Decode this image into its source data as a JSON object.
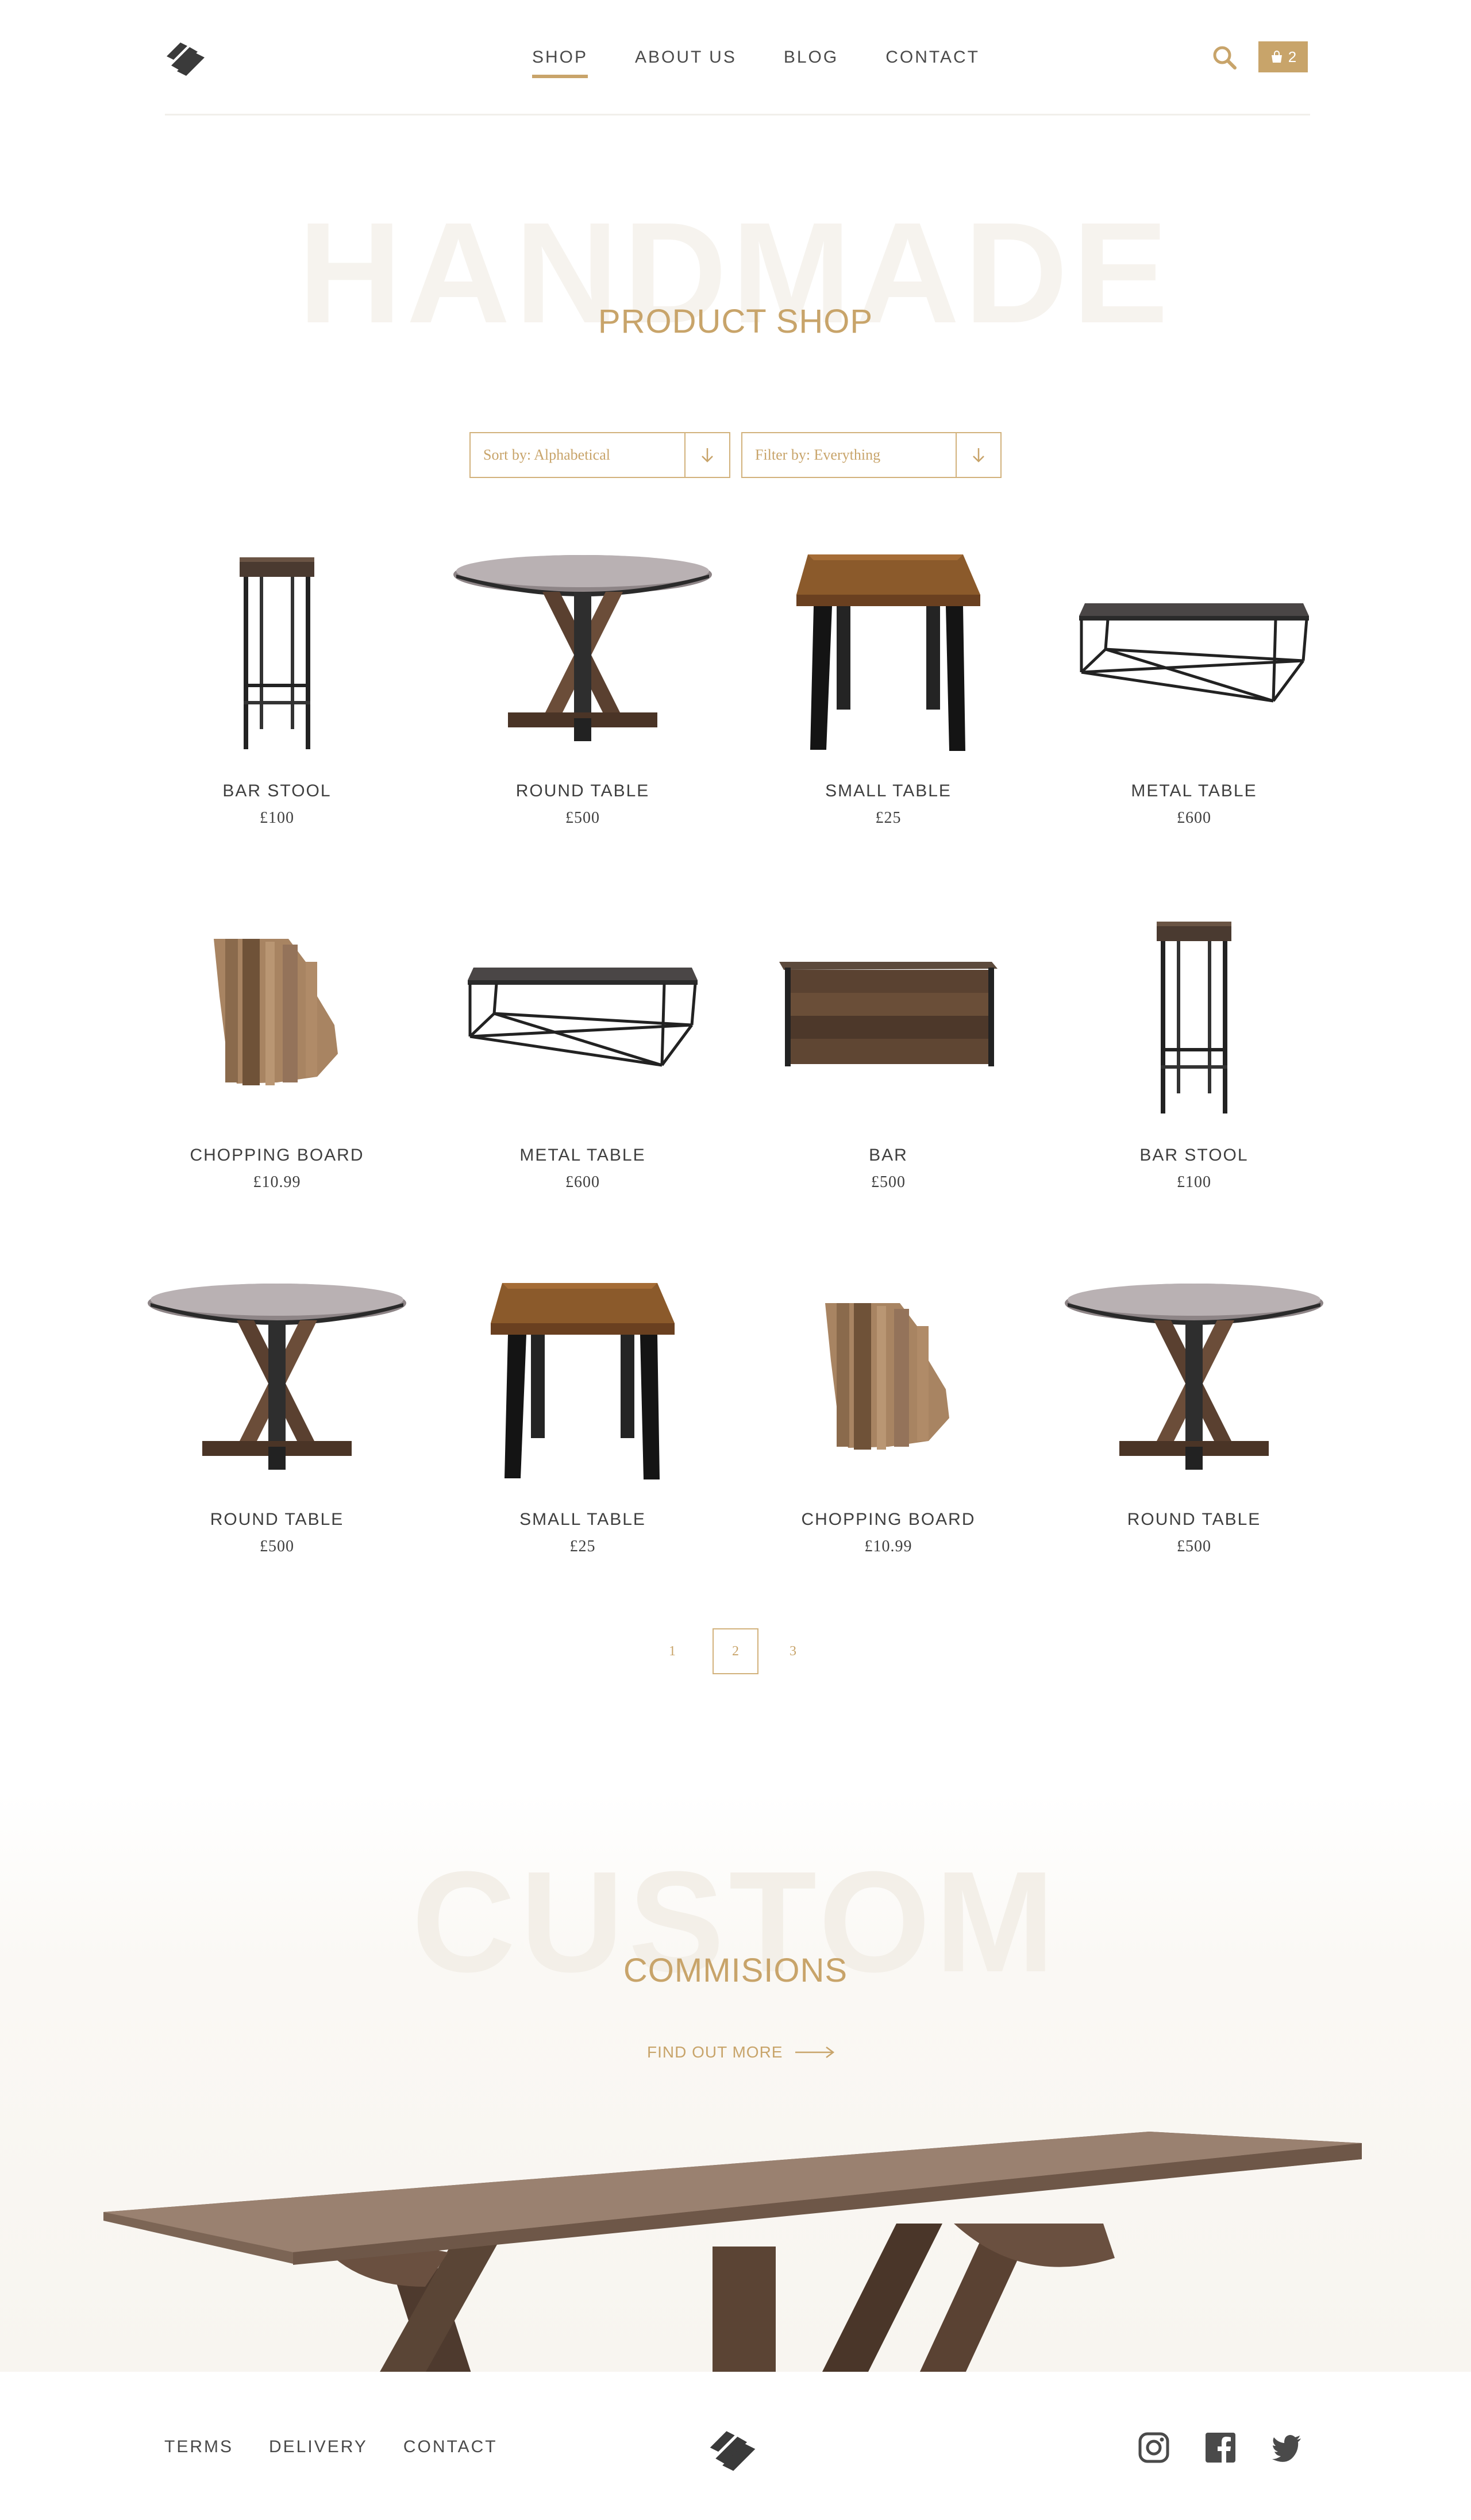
{
  "header": {
    "nav": [
      {
        "label": "SHOP",
        "active": true
      },
      {
        "label": "ABOUT US",
        "active": false
      },
      {
        "label": "BLOG",
        "active": false
      },
      {
        "label": "CONTACT",
        "active": false
      }
    ],
    "cart_count": "2",
    "icons": {
      "logo": "logo-mark",
      "search": "search-icon",
      "cart": "shopping-bag-icon"
    }
  },
  "hero": {
    "background_word": "HANDMADE",
    "subtitle": "PRODUCT SHOP"
  },
  "filters": {
    "sort_label": "Sort by: Alphabetical",
    "filter_label": "Filter by: Everything"
  },
  "products": [
    {
      "name": "BAR STOOL",
      "price": "£100",
      "image": "bar-stool"
    },
    {
      "name": "ROUND TABLE",
      "price": "£500",
      "image": "round-table"
    },
    {
      "name": "SMALL TABLE",
      "price": "£25",
      "image": "small-table"
    },
    {
      "name": "METAL TABLE",
      "price": "£600",
      "image": "metal-table"
    },
    {
      "name": "CHOPPING BOARD",
      "price": "£10.99",
      "image": "chopping-board"
    },
    {
      "name": "METAL TABLE",
      "price": "£600",
      "image": "metal-table"
    },
    {
      "name": "BAR",
      "price": "£500",
      "image": "bar"
    },
    {
      "name": "BAR STOOL",
      "price": "£100",
      "image": "bar-stool"
    },
    {
      "name": "ROUND TABLE",
      "price": "£500",
      "image": "round-table"
    },
    {
      "name": "SMALL TABLE",
      "price": "£25",
      "image": "small-table"
    },
    {
      "name": "CHOPPING BOARD",
      "price": "£10.99",
      "image": "chopping-board"
    },
    {
      "name": "ROUND TABLE",
      "price": "£500",
      "image": "round-table"
    }
  ],
  "pagination": {
    "pages": [
      "1",
      "2",
      "3"
    ],
    "current": "2"
  },
  "custom": {
    "background_word": "CUSTOM",
    "subtitle": "COMMISIONS",
    "cta": "FIND OUT MORE"
  },
  "footer": {
    "links": [
      "TERMS",
      "DELIVERY",
      "CONTACT"
    ],
    "social": [
      "instagram-icon",
      "facebook-icon",
      "twitter-icon"
    ]
  },
  "colors": {
    "accent": "#c8a46a",
    "text": "#3f3f3f",
    "faint": "#f6f3ee"
  }
}
